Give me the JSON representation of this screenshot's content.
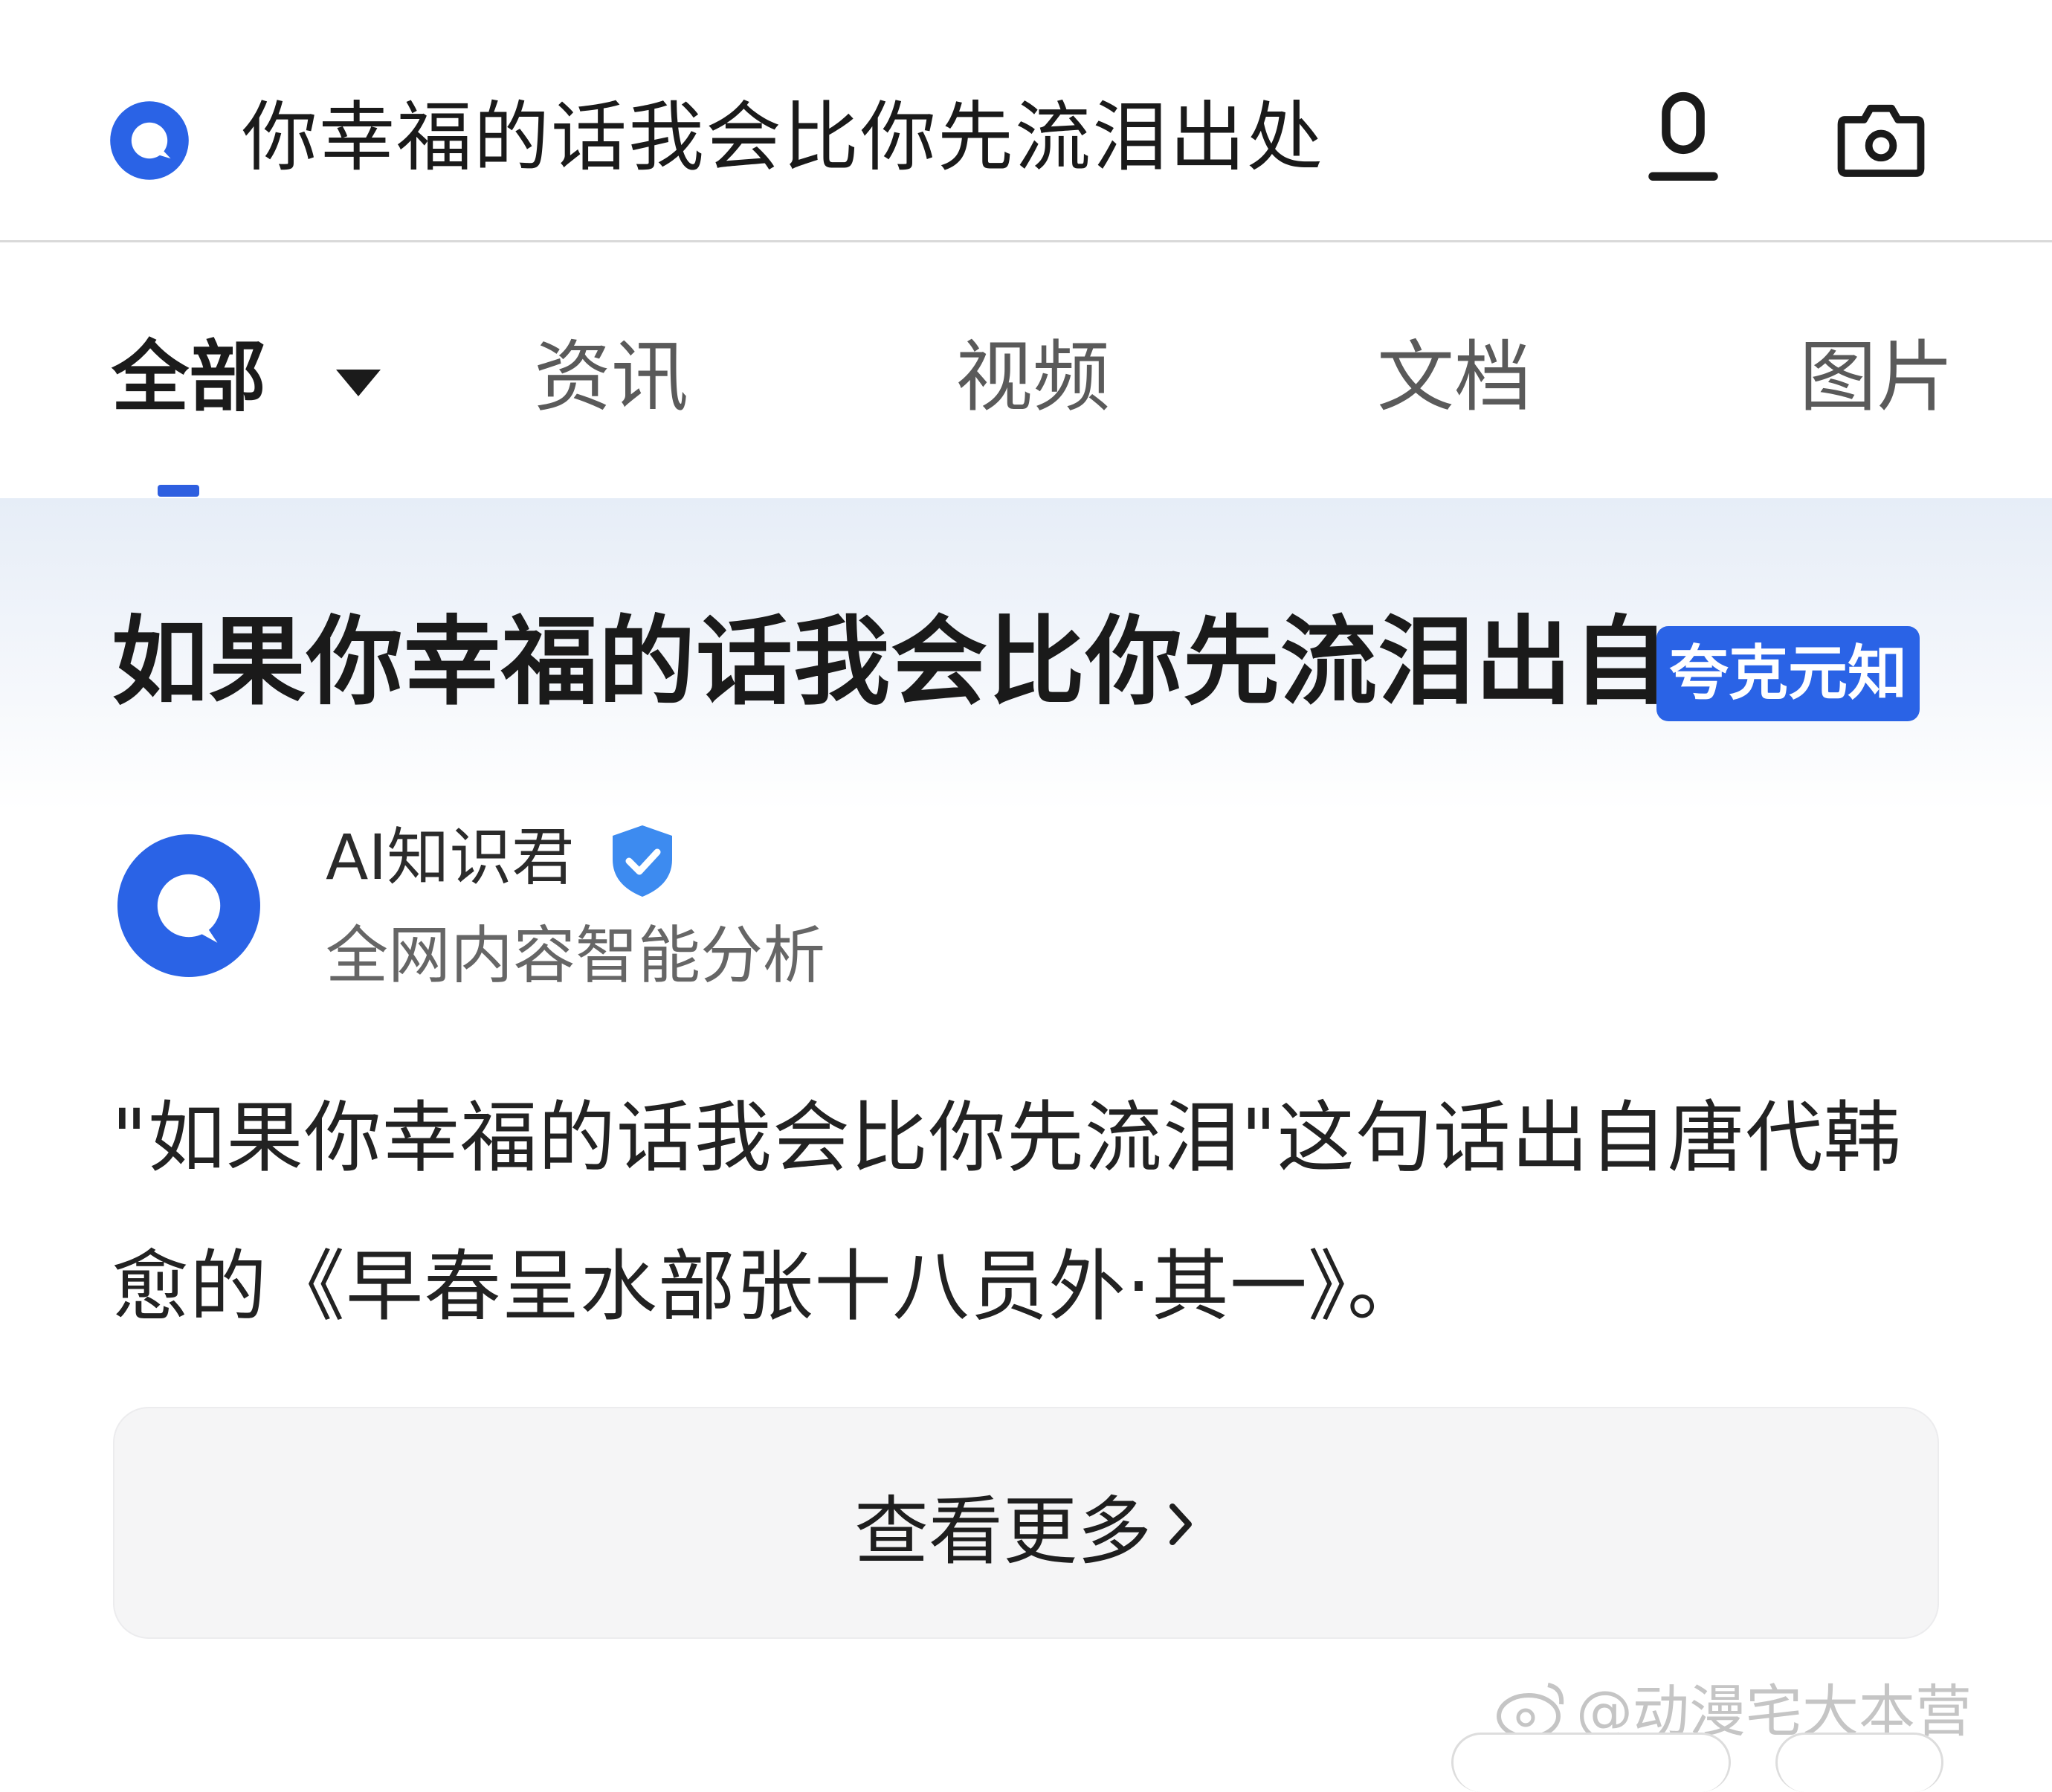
{
  "search": {
    "query": "你幸福的话我会比你先流泪出处",
    "icons": [
      "quark-logo-icon",
      "microphone-icon",
      "camera-icon"
    ],
    "accent_color": "#2a63e6"
  },
  "tabs": [
    {
      "label": "全部",
      "active": true
    },
    {
      "label": "资讯",
      "active": false
    },
    {
      "label": "视频",
      "active": false
    },
    {
      "label": "文档",
      "active": false
    },
    {
      "label": "图片",
      "active": false
    }
  ],
  "answer": {
    "title": "如果你幸福的话我会比你先流泪出自",
    "badge": "夸克元知",
    "author": {
      "name": "AI知识君",
      "description": "全网内容智能分析",
      "verified": true
    },
    "body": "\"如果你幸福的话我会比你先流泪\"这句话出自唐代韩愈的《早春呈水部张十八员外·其一》。",
    "more_label": "查看更多"
  },
  "watermark": "@动漫宅大本营"
}
